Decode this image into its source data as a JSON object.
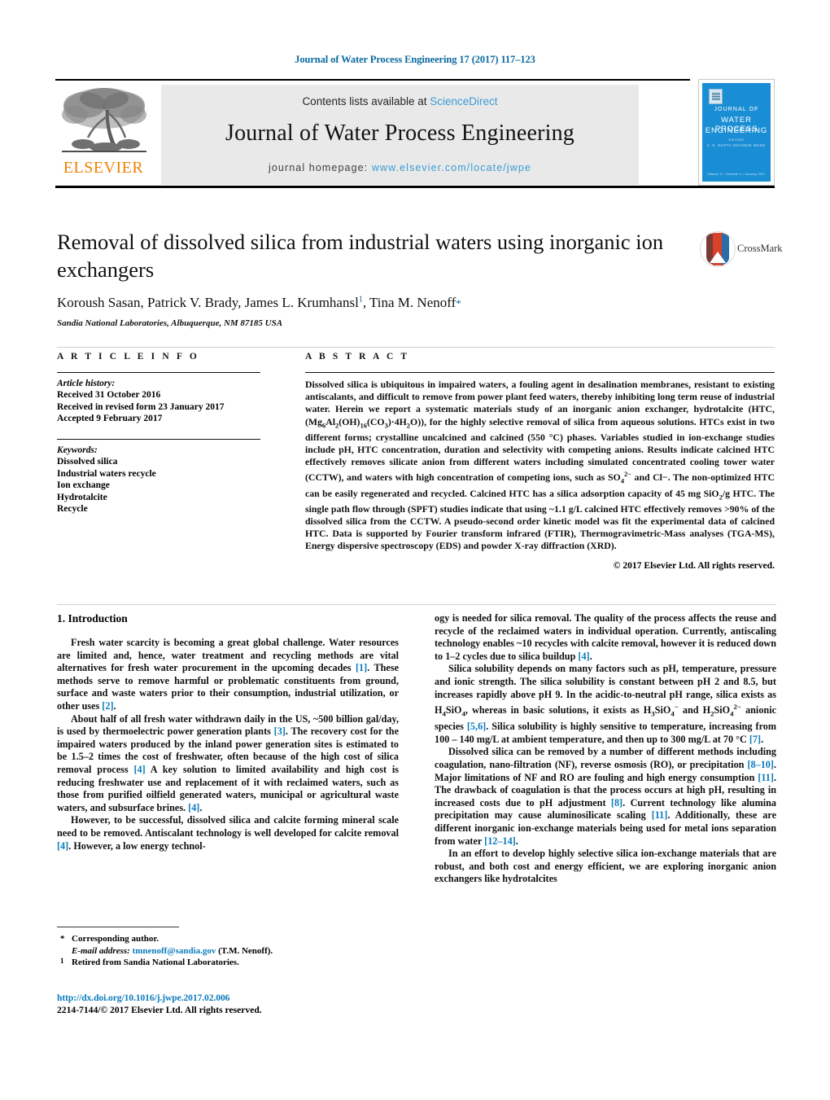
{
  "running_head": "Journal of Water Process Engineering 17 (2017) 117–123",
  "masthead": {
    "contents_prefix": "Contents lists available at ",
    "sciencedirect": "ScienceDirect",
    "journal_title": "Journal of Water Process Engineering",
    "homepage_label": "journal homepage: ",
    "homepage_url": "www.elsevier.com/locate/jwpe",
    "publisher": "ELSEVIER",
    "link_color": "#3a9bd4",
    "publisher_color": "#ef8200"
  },
  "cover": {
    "line1": "JOURNAL OF",
    "line2": "WATER PROCESS",
    "line3": "ENGINEERING",
    "editors_label": "EDITORS",
    "editors": "V. K. GUPTA    SHAOBIN WANG",
    "footer": "Volume 17 • Number 1 • January 2017",
    "background": "#1a8ed4"
  },
  "article": {
    "title": "Removal of dissolved silica from industrial waters using inorganic ion exchangers",
    "authors": "Koroush Sasan, Patrick V. Brady, James L. Krumhansl",
    "author_footnote": "1",
    "author_tail": ", Tina M. Nenoff",
    "corresponding_star": "*",
    "affiliation": "Sandia National Laboratories, Albuquerque, NM 87185 USA",
    "crossmark_label": "CrossMark"
  },
  "article_info": {
    "heading": "A R T I C L E    I N F O",
    "history_label": "Article history:",
    "history": [
      "Received 31 October 2016",
      "Received in revised form 23 January 2017",
      "Accepted 9 February 2017"
    ],
    "keywords_label": "Keywords:",
    "keywords": [
      "Dissolved silica",
      "Industrial waters recycle",
      "Ion exchange",
      "Hydrotalcite",
      "Recycle"
    ]
  },
  "abstract": {
    "heading": "A B S T R A C T",
    "text": "Dissolved silica is ubiquitous in impaired waters, a fouling agent in desalination membranes, resistant to existing antiscalants, and difficult to remove from power plant feed waters, thereby inhibiting long term reuse of industrial water. Herein we report a systematic materials study of an inorganic anion exchanger, hydrotalcite (HTC, (Mg6Al2(OH)16(CO3)·4H2O)), for the highly selective removal of silica from aqueous solutions. HTCs exist in two different forms; crystalline uncalcined and calcined (550 °C) phases. Variables studied in ion-exchange studies include pH, HTC concentration, duration and selectivity with competing anions. Results indicate calcined HTC effectively removes silicate anion from different waters including simulated concentrated cooling tower water (CCTW), and waters with high concentration of competing ions, such as SO42− and Cl−. The non-optimized HTC can be easily regenerated and recycled. Calcined HTC has a silica adsorption capacity of 45 mg SiO2/g HTC. The single path flow through (SPFT) studies indicate that using ~1.1 g/L calcined HTC effectively removes >90% of the dissolved silica from the CCTW. A pseudo-second order kinetic model was fit the experimental data of calcined HTC. Data is supported by Fourier transform infrared (FTIR), Thermogravimetric-Mass analyses (TGA-MS), Energy dispersive spectroscopy (EDS) and powder X-ray diffraction (XRD).",
    "copyright": "© 2017 Elsevier Ltd. All rights reserved."
  },
  "body": {
    "section_number": "1.",
    "section_title": "Introduction",
    "left_paragraphs": [
      "Fresh water scarcity is becoming a great global challenge. Water resources are limited and, hence, water treatment and recycling methods are vital alternatives for fresh water procurement in the upcoming decades [1]. These methods serve to remove harmful or problematic constituents from ground, surface and waste waters prior to their consumption, industrial utilization, or other uses [2].",
      "About half of all fresh water withdrawn daily in the US, ~500 billion gal/day, is used by thermoelectric power generation plants [3]. The recovery cost for the impaired waters produced by the inland power generation sites is estimated to be 1.5–2 times the cost of freshwater, often because of the high cost of silica removal process [4] A key solution to limited availability and high cost is reducing freshwater use and replacement of it with reclaimed waters, such as those from purified oilfield generated waters, municipal or agricultural waste waters, and subsurface brines. [4].",
      "However, to be successful, dissolved silica and calcite forming mineral scale need to be removed. Antiscalant technology is well developed for calcite removal [4]. However, a low energy technol-"
    ],
    "right_paragraphs": [
      "ogy is needed for silica removal. The quality of the process affects the reuse and recycle of the reclaimed waters in individual operation. Currently, antiscaling technology enables ~10 recycles with calcite removal, however it is reduced down to 1–2 cycles due to silica buildup [4].",
      "Silica solubility depends on many factors such as pH, temperature, pressure and ionic strength. The silica solubility is constant between pH 2 and 8.5, but increases rapidly above pH 9. In the acidic-to-neutral pH range, silica exists as H4SiO4, whereas in basic solutions, it exists as H3SiO4− and H2SiO42− anionic species [5,6]. Silica solubility is highly sensitive to temperature, increasing from 100 – 140 mg/L at ambient temperature, and then up to 300 mg/L at 70 °C [7].",
      "Dissolved silica can be removed by a number of different methods including coagulation, nano-filtration (NF), reverse osmosis (RO), or precipitation [8–10]. Major limitations of NF and RO are fouling and high energy consumption [11]. The drawback of coagulation is that the process occurs at high pH, resulting in increased costs due to pH adjustment [8]. Current technology like alumina precipitation may cause aluminosilicate scaling [11]. Additionally, these are different inorganic ion-exchange materials being used for metal ions separation from water [12–14].",
      "In an effort to develop highly selective silica ion-exchange materials that are robust, and both cost and energy efficient, we are exploring inorganic anion exchangers like hydrotalcites"
    ]
  },
  "footnotes": {
    "corresponding_mark": "*",
    "corresponding_text": "Corresponding author.",
    "email_label": "E-mail address:",
    "email": "tmnenoff@sandia.gov",
    "email_owner": "(T.M. Nenoff).",
    "retired_mark": "1",
    "retired_text": "Retired from Sandia National Laboratories."
  },
  "footer": {
    "doi": "http://dx.doi.org/10.1016/j.jwpe.2017.02.006",
    "issn_line": "2214-7144/© 2017 Elsevier Ltd. All rights reserved.",
    "link_color": "#0b7bbd"
  }
}
